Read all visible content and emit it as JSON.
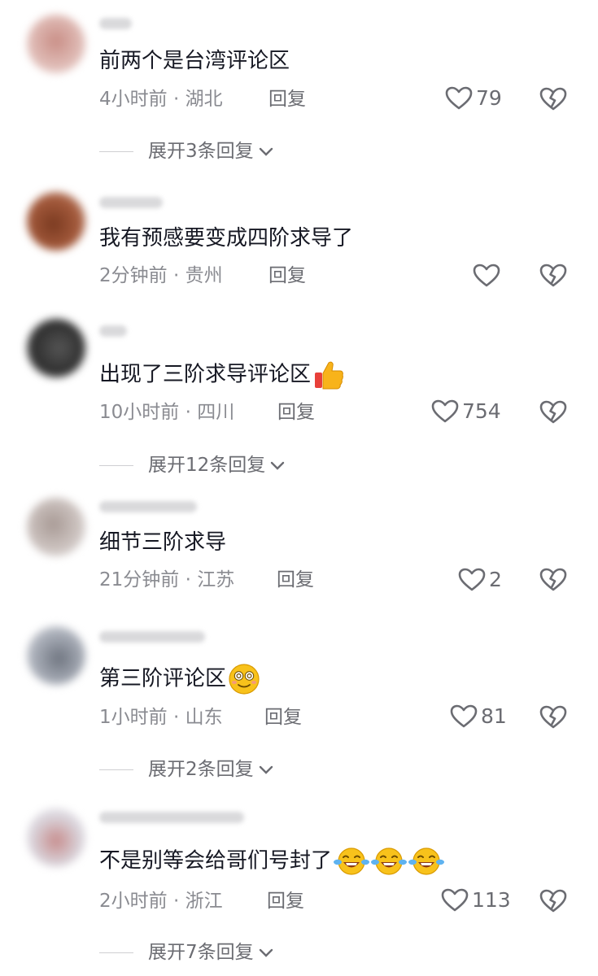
{
  "comments": [
    {
      "text": "前两个是台湾评论区",
      "time": "4小时前",
      "location": "湖北",
      "reply": "回复",
      "likes": "79",
      "expand": "展开3条回复"
    },
    {
      "text": "我有预感要变成四阶求导了",
      "time": "2分钟前",
      "location": "贵州",
      "reply": "回复",
      "likes": "",
      "expand": ""
    },
    {
      "text": "出现了三阶求导评论区",
      "time": "10小时前",
      "location": "四川",
      "reply": "回复",
      "likes": "754",
      "expand": "展开12条回复",
      "emoji": "thumbs-up"
    },
    {
      "text": "细节三阶求导",
      "time": "21分钟前",
      "location": "江苏",
      "reply": "回复",
      "likes": "2",
      "expand": ""
    },
    {
      "text": "第三阶评论区",
      "time": "1小时前",
      "location": "山东",
      "reply": "回复",
      "likes": "81",
      "expand": "展开2条回复",
      "emoji": "dizzy-face"
    },
    {
      "text": "不是别等会给哥们号封了",
      "time": "2小时前",
      "location": "浙江",
      "reply": "回复",
      "likes": "113",
      "expand": "展开7条回复",
      "emoji": "laughing-tears x3"
    }
  ],
  "separator": " · "
}
